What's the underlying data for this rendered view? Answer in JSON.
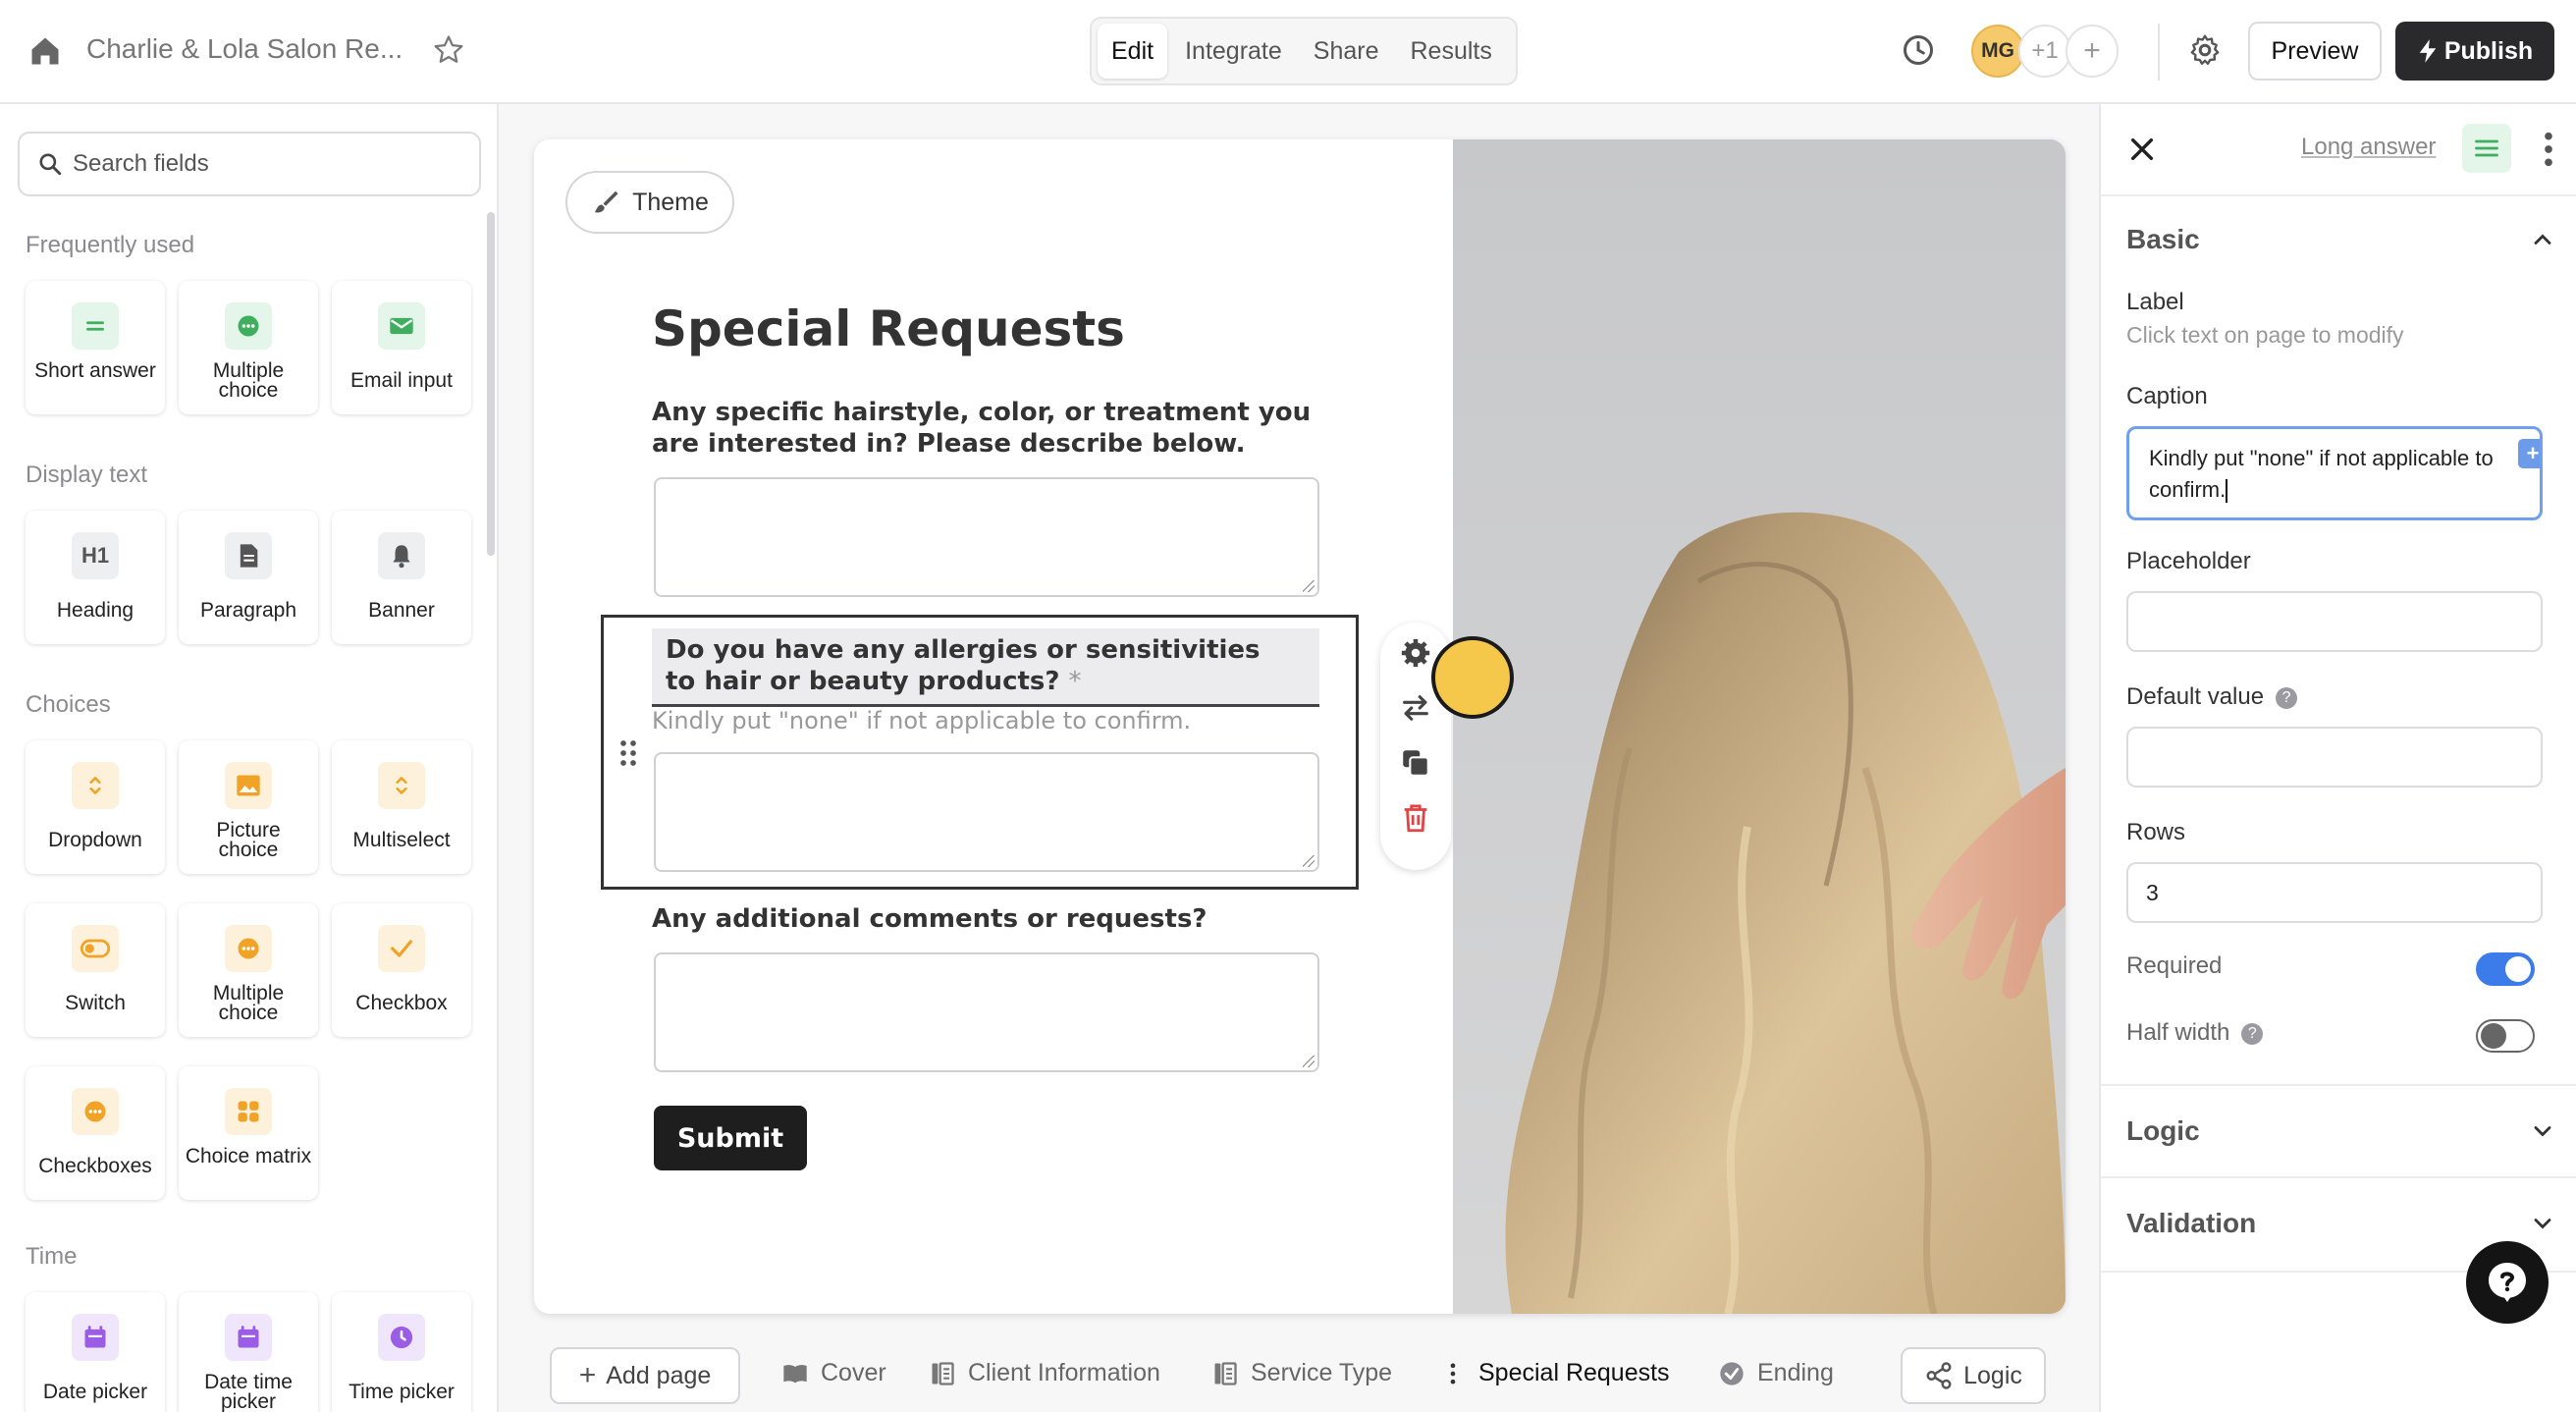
{
  "header": {
    "form_title": "Charlie & Lola Salon Re...",
    "tabs": [
      {
        "label": "Edit",
        "active": true
      },
      {
        "label": "Integrate",
        "active": false
      },
      {
        "label": "Share",
        "active": false
      },
      {
        "label": "Results",
        "active": false
      }
    ],
    "avatar_initials": "MG",
    "extra_collaborators": "+1",
    "add_collaborator": "+",
    "preview_label": "Preview",
    "publish_label": "Publish"
  },
  "sidebar": {
    "search_placeholder": "Search fields",
    "sections": {
      "frequently_used": "Frequently used",
      "display_text": "Display text",
      "choices": "Choices",
      "time": "Time"
    },
    "frequently_used": [
      {
        "label": "Short answer",
        "icon": "short-answer-icon"
      },
      {
        "label": "Multiple choice",
        "icon": "multiple-choice-icon"
      },
      {
        "label": "Email input",
        "icon": "email-icon"
      }
    ],
    "display_text": [
      {
        "label": "Heading",
        "icon": "heading-icon"
      },
      {
        "label": "Paragraph",
        "icon": "paragraph-icon"
      },
      {
        "label": "Banner",
        "icon": "bell-icon"
      }
    ],
    "choices": [
      {
        "label": "Dropdown",
        "icon": "dropdown-icon"
      },
      {
        "label": "Picture choice",
        "icon": "picture-icon"
      },
      {
        "label": "Multiselect",
        "icon": "multiselect-icon"
      },
      {
        "label": "Switch",
        "icon": "switch-icon"
      },
      {
        "label": "Multiple choice",
        "icon": "multiple-choice-icon"
      },
      {
        "label": "Checkbox",
        "icon": "checkbox-icon"
      },
      {
        "label": "Checkboxes",
        "icon": "checkboxes-icon"
      },
      {
        "label": "Choice matrix",
        "icon": "matrix-icon"
      }
    ],
    "time": [
      {
        "label": "Date picker",
        "icon": "calendar-icon"
      },
      {
        "label": "Date time picker",
        "icon": "calendar-icon"
      },
      {
        "label": "Time picker",
        "icon": "clock-icon"
      }
    ]
  },
  "canvas": {
    "theme_label": "Theme",
    "page_title": "Special Requests",
    "q1_label": "Any specific hairstyle, color, or treatment you are interested in? Please describe below.",
    "q2_label": "Do you have any allergies or sensitivities to hair or beauty products?",
    "q2_required_mark": "*",
    "q2_caption": "Kindly put \"none\" if not applicable to confirm.",
    "q3_label": "Any additional comments or requests?",
    "submit_label": "Submit"
  },
  "pages_bar": {
    "add_page_label": "Add page",
    "pages": [
      {
        "label": "Cover",
        "icon": "book-icon",
        "active": false
      },
      {
        "label": "Client Information",
        "icon": "form-page-icon",
        "active": false
      },
      {
        "label": "Service Type",
        "icon": "form-page-icon",
        "active": false
      },
      {
        "label": "Special Requests",
        "icon": "drag-dots-icon",
        "active": true
      },
      {
        "label": "Ending",
        "icon": "check-circle-icon",
        "active": false
      }
    ],
    "logic_label": "Logic"
  },
  "panel": {
    "field_type": "Long answer",
    "basic_heading": "Basic",
    "label_title": "Label",
    "label_hint": "Click text on page to modify",
    "caption_title": "Caption",
    "caption_value": "Kindly put \"none\" if not applicable to confirm.",
    "placeholder_title": "Placeholder",
    "placeholder_value": "",
    "default_value_title": "Default value",
    "default_value": "",
    "rows_title": "Rows",
    "rows_value": "3",
    "required_title": "Required",
    "required_on": true,
    "half_width_title": "Half width",
    "half_width_on": false,
    "logic_heading": "Logic",
    "validation_heading": "Validation"
  },
  "colors": {
    "accent": "#3b7bea",
    "publish_bg": "#2a2a2c",
    "green_icon": "#3fae5f",
    "orange_icon": "#f0a326",
    "purple_icon": "#9b5de5",
    "delete_red": "#e04444"
  }
}
